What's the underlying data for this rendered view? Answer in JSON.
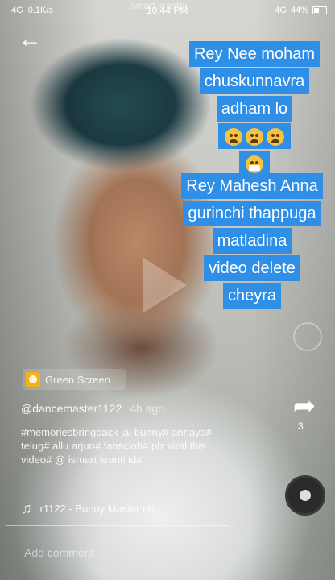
{
  "status_bar": {
    "network": "4G",
    "speed": "0.1K/s",
    "time": "10:44 PM",
    "overlay_text": "ismart kranthi",
    "lte": "4G",
    "battery": "44%"
  },
  "caption": {
    "lines1": [
      "Rey Nee moham",
      "chuskunnavra",
      "adham lo"
    ],
    "lines2": [
      "Rey Mahesh Anna",
      "gurinchi thappuga",
      "matladina",
      "video delete",
      "cheyra"
    ]
  },
  "effect_label": "Green Screen",
  "author": "@dancemaster1122",
  "time_ago": "4h ago",
  "description": "#memoriesbringback  jai bunny# annaya# telug# allu arjun# fansclob# plz  viral this video# @ ismart kranti id#",
  "music": "r1122 - Bunny Master    ori",
  "comment_placeholder": "Add comment",
  "share_count": "3",
  "icons": {
    "back": "back-arrow-icon",
    "play": "play-icon",
    "share": "share-icon",
    "music": "music-note-icon"
  }
}
